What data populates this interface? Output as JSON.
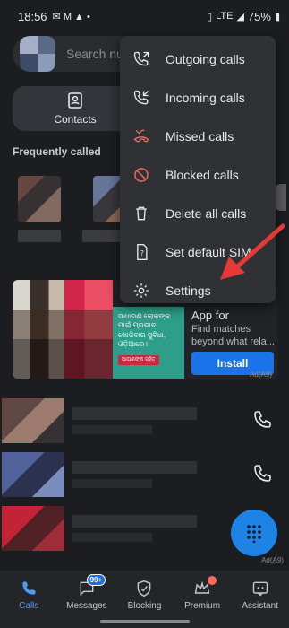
{
  "status_bar": {
    "time": "18:56",
    "battery": "75%",
    "indicators": "✉ M ▲ •",
    "network": "LTE"
  },
  "search": {
    "placeholder": "Search num"
  },
  "tab": {
    "label": "Contacts"
  },
  "section": {
    "frequently_called": "Frequently called"
  },
  "menu": {
    "items": [
      {
        "label": "Outgoing calls",
        "icon": "outgoing-call-icon"
      },
      {
        "label": "Incoming calls",
        "icon": "incoming-call-icon"
      },
      {
        "label": "Missed calls",
        "icon": "missed-call-icon"
      },
      {
        "label": "Blocked calls",
        "icon": "blocked-icon"
      },
      {
        "label": "Delete all calls",
        "icon": "trash-icon"
      },
      {
        "label": "Set default SIM",
        "icon": "sim-icon"
      },
      {
        "label": "Settings",
        "icon": "gear-icon"
      }
    ]
  },
  "ad": {
    "headline": "App for",
    "sub": "Find matches beyond what rela...",
    "install": "Install",
    "tag": "Ad(A9)",
    "banner_text": "ସାଧାରଣ ଲୋକଙ୍କ ପାଇଁ ପ୍ରଭାବ ଖୋଜିବାର ସୁବିଧା, ଓଡ଼ିଆରେ।",
    "banner_button": "ଆପଣଙ୍କ ସହିତ"
  },
  "ad_bottom_tag": "Ad(A9)",
  "nav": {
    "items": [
      {
        "label": "Calls",
        "active": true
      },
      {
        "label": "Messages",
        "badge": "99+"
      },
      {
        "label": "Blocking"
      },
      {
        "label": "Premium",
        "dot": true
      },
      {
        "label": "Assistant"
      }
    ]
  },
  "colors": {
    "accent": "#1d84e6",
    "arrow": "#e53935",
    "missed": "#f06a5a",
    "blocked": "#f06a5a"
  }
}
